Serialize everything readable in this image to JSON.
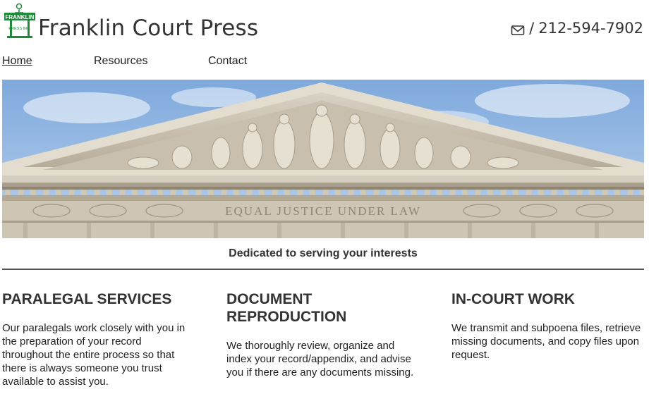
{
  "header": {
    "brand": "Franklin Court Press",
    "logo_text_top": "FRANKLIN",
    "logo_text_bottom": "PRESS INC.",
    "contact_icon": "mail-icon",
    "contact_separator": "/",
    "phone": "212-594-7902"
  },
  "nav": {
    "items": [
      {
        "label": "Home"
      },
      {
        "label": "Resources"
      },
      {
        "label": "Contact"
      }
    ]
  },
  "hero": {
    "inscription": "EQUAL JUSTICE UNDER LAW"
  },
  "tagline": "Dedicated to serving your interests",
  "services": [
    {
      "title": "PARALEGAL SERVICES",
      "body": "Our paralegals work closely with you in the preparation of your record throughout the entire process so that there is always someone you trust available to assist you."
    },
    {
      "title": "DOCUMENT REPRODUCTION",
      "body": "We thoroughly review, organize and index your record/appendix, and advise you if there are any documents missing."
    },
    {
      "title": "IN-COURT WORK",
      "body": "We transmit and subpoena files, retrieve missing documents, and copy files upon request."
    }
  ],
  "colors": {
    "logo_green": "#1f8a3a",
    "rule": "#555555",
    "sky": "#8fb6e0"
  }
}
